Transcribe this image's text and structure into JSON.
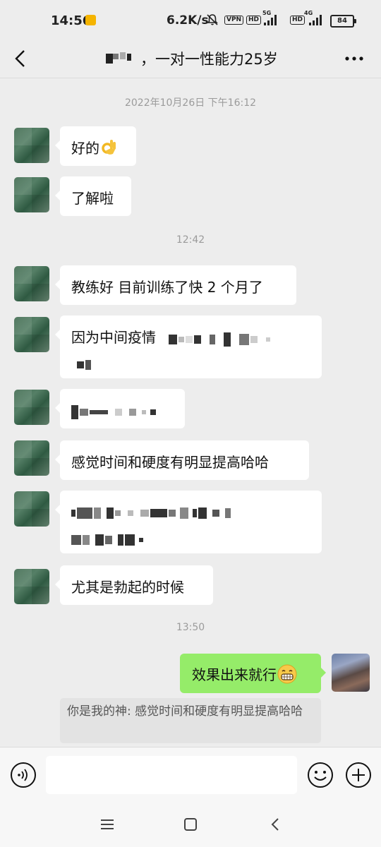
{
  "status_bar": {
    "time": "14:56",
    "net_speed": "6.2K/s",
    "vpn": "VPN",
    "hd1": "HD",
    "gen1": "5G",
    "hd2": "HD",
    "gen2": "4G",
    "battery": "84"
  },
  "header": {
    "title": "，一对一性能力25岁"
  },
  "messages": {
    "ts1": "2022年10月26日 下午16:12",
    "m1": "好的",
    "m2": "了解啦",
    "ts2": "12:42",
    "m3": "教练好 目前训练了快 2 个月了",
    "m4": "因为中间疫情",
    "m6": "感觉时间和硬度有明显提高哈哈",
    "m8": "尤其是勃起的时候",
    "ts3": "13:50",
    "m9": "效果出来就行",
    "quote": "你是我的神: 感觉时间和硬度有明显提高哈哈"
  },
  "input": {
    "placeholder": ""
  },
  "icons": {
    "back": "back-arrow-icon",
    "more": "more-icon",
    "voice": "voice-icon",
    "emoji": "emoji-icon",
    "plus": "plus-icon"
  },
  "colors": {
    "background": "#ededed",
    "sent_bubble": "#95ec69",
    "received_bubble": "#ffffff"
  }
}
